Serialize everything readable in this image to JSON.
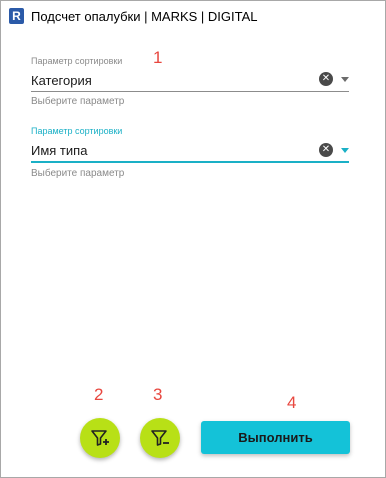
{
  "window": {
    "title": "Подсчет опалубки | MARKS | DIGITAL",
    "icon_letter": "R"
  },
  "fields": [
    {
      "label": "Параметр сортировки",
      "value": "Категория",
      "hint": "Выберите параметр",
      "active": false
    },
    {
      "label": "Параметр сортировки",
      "value": "Имя типа",
      "hint": "Выберите параметр",
      "active": true
    }
  ],
  "annotations": [
    "1",
    "2",
    "3",
    "4"
  ],
  "buttons": {
    "add_filter_icon": "filter-plus-icon",
    "remove_filter_icon": "filter-minus-icon",
    "run_label": "Выполнить"
  },
  "colors": {
    "accent": "#1ab0c6",
    "filter_button": "#b8e016",
    "run_button": "#14c2d8",
    "annotation": "#e8473f"
  }
}
